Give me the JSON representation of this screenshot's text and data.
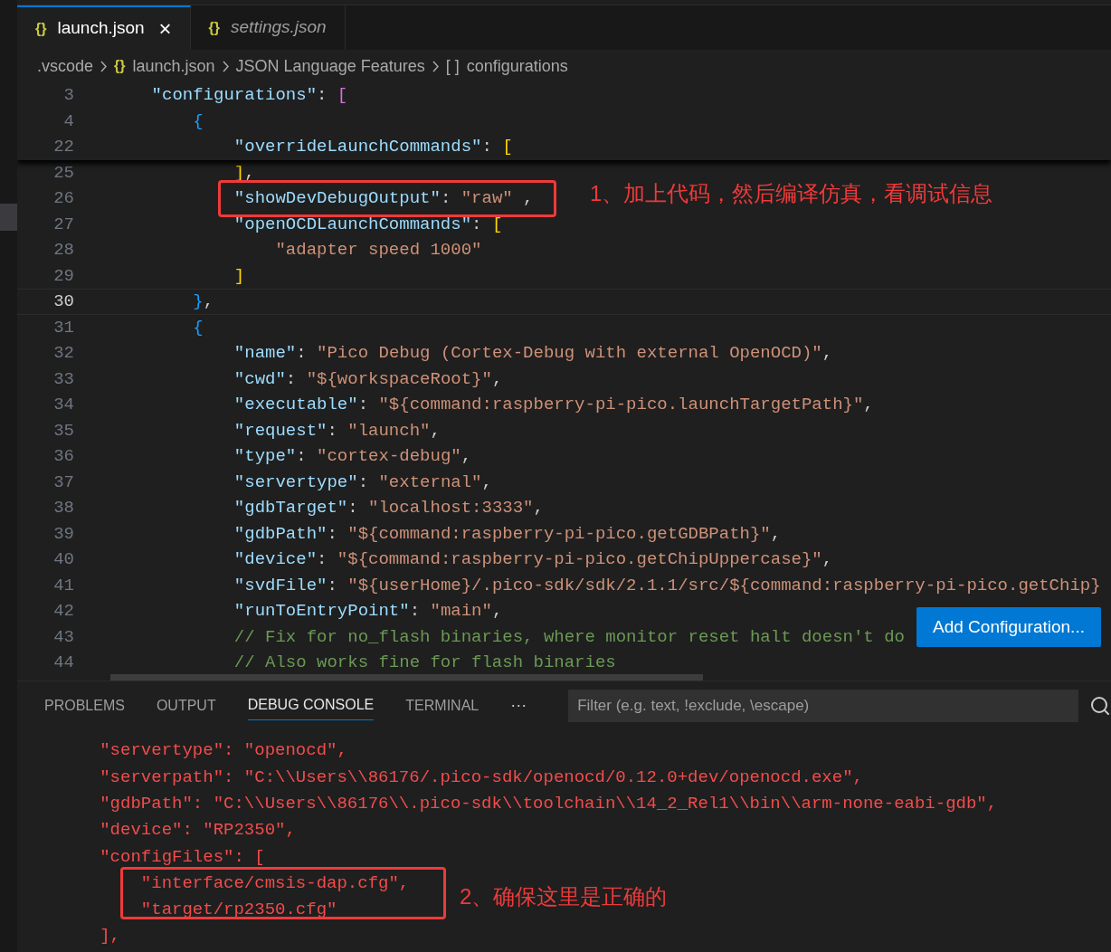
{
  "tabs": [
    {
      "icon": "{}",
      "label": "launch.json",
      "selected": true,
      "preview": false,
      "close": "×"
    },
    {
      "icon": "{}",
      "label": "settings.json",
      "selected": false,
      "preview": true
    }
  ],
  "breadcrumb": [
    {
      "label": ".vscode"
    },
    {
      "icon": "{}",
      "label": "launch.json"
    },
    {
      "label": "JSON Language Features"
    },
    {
      "icon": "[ ]",
      "label": "configurations"
    }
  ],
  "editor": {
    "sticky_lines": [
      {
        "number": "3",
        "current": false,
        "tokens": [
          {
            "kind": "key",
            "t": "    \"configurations\""
          },
          {
            "kind": "punc",
            "t": ": "
          },
          {
            "kind": "pink",
            "t": "["
          }
        ]
      },
      {
        "number": "4",
        "current": false,
        "tokens": [
          {
            "kind": "blue",
            "t": "        {"
          }
        ]
      },
      {
        "number": "22",
        "current": false,
        "tokens": [
          {
            "kind": "key",
            "t": "            \"overrideLaunchCommands\""
          },
          {
            "kind": "punc",
            "t": ": "
          },
          {
            "kind": "yellow",
            "t": "["
          }
        ]
      }
    ],
    "lines": [
      {
        "number": "25",
        "current": false,
        "boxed": false,
        "tokens": [
          {
            "kind": "yellow",
            "t": "            ]"
          },
          {
            "kind": "punc",
            "t": ","
          }
        ]
      },
      {
        "number": "26",
        "current": false,
        "boxed": true,
        "tokens": [
          {
            "kind": "key",
            "t": "            \"showDevDebugOutput\""
          },
          {
            "kind": "punc",
            "t": ": "
          },
          {
            "kind": "str",
            "t": "\"raw\""
          },
          {
            "kind": "punc",
            "t": " ,"
          }
        ]
      },
      {
        "number": "27",
        "current": false,
        "boxed": false,
        "tokens": [
          {
            "kind": "key",
            "t": "            \"openOCDLaunchCommands\""
          },
          {
            "kind": "punc",
            "t": ": "
          },
          {
            "kind": "yellow",
            "t": "["
          }
        ]
      },
      {
        "number": "28",
        "current": false,
        "boxed": false,
        "tokens": [
          {
            "kind": "str",
            "t": "                \"adapter speed 1000\""
          }
        ]
      },
      {
        "number": "29",
        "current": false,
        "boxed": false,
        "tokens": [
          {
            "kind": "yellow",
            "t": "            ]"
          }
        ]
      },
      {
        "number": "30",
        "current": true,
        "boxed": false,
        "tokens": [
          {
            "kind": "blue",
            "t": "        }"
          },
          {
            "kind": "punc",
            "t": ","
          }
        ]
      },
      {
        "number": "31",
        "current": false,
        "boxed": false,
        "tokens": [
          {
            "kind": "blue",
            "t": "        {"
          }
        ]
      },
      {
        "number": "32",
        "current": false,
        "boxed": false,
        "tokens": [
          {
            "kind": "key",
            "t": "            \"name\""
          },
          {
            "kind": "punc",
            "t": ": "
          },
          {
            "kind": "str",
            "t": "\"Pico Debug (Cortex-Debug with external OpenOCD)\""
          },
          {
            "kind": "punc",
            "t": ","
          }
        ]
      },
      {
        "number": "33",
        "current": false,
        "boxed": false,
        "tokens": [
          {
            "kind": "key",
            "t": "            \"cwd\""
          },
          {
            "kind": "punc",
            "t": ": "
          },
          {
            "kind": "str",
            "t": "\"${workspaceRoot}\""
          },
          {
            "kind": "punc",
            "t": ","
          }
        ]
      },
      {
        "number": "34",
        "current": false,
        "boxed": false,
        "tokens": [
          {
            "kind": "key",
            "t": "            \"executable\""
          },
          {
            "kind": "punc",
            "t": ": "
          },
          {
            "kind": "str",
            "t": "\"${command:raspberry-pi-pico.launchTargetPath}\""
          },
          {
            "kind": "punc",
            "t": ","
          }
        ]
      },
      {
        "number": "35",
        "current": false,
        "boxed": false,
        "tokens": [
          {
            "kind": "key",
            "t": "            \"request\""
          },
          {
            "kind": "punc",
            "t": ": "
          },
          {
            "kind": "str",
            "t": "\"launch\""
          },
          {
            "kind": "punc",
            "t": ","
          }
        ]
      },
      {
        "number": "36",
        "current": false,
        "boxed": false,
        "tokens": [
          {
            "kind": "key",
            "t": "            \"type\""
          },
          {
            "kind": "punc",
            "t": ": "
          },
          {
            "kind": "str",
            "t": "\"cortex-debug\""
          },
          {
            "kind": "punc",
            "t": ","
          }
        ]
      },
      {
        "number": "37",
        "current": false,
        "boxed": false,
        "tokens": [
          {
            "kind": "key",
            "t": "            \"servertype\""
          },
          {
            "kind": "punc",
            "t": ": "
          },
          {
            "kind": "str",
            "t": "\"external\""
          },
          {
            "kind": "punc",
            "t": ","
          }
        ]
      },
      {
        "number": "38",
        "current": false,
        "boxed": false,
        "tokens": [
          {
            "kind": "key",
            "t": "            \"gdbTarget\""
          },
          {
            "kind": "punc",
            "t": ": "
          },
          {
            "kind": "str",
            "t": "\"localhost:3333\""
          },
          {
            "kind": "punc",
            "t": ","
          }
        ]
      },
      {
        "number": "39",
        "current": false,
        "boxed": false,
        "tokens": [
          {
            "kind": "key",
            "t": "            \"gdbPath\""
          },
          {
            "kind": "punc",
            "t": ": "
          },
          {
            "kind": "str",
            "t": "\"${command:raspberry-pi-pico.getGDBPath}\""
          },
          {
            "kind": "punc",
            "t": ","
          }
        ]
      },
      {
        "number": "40",
        "current": false,
        "boxed": false,
        "tokens": [
          {
            "kind": "key",
            "t": "            \"device\""
          },
          {
            "kind": "punc",
            "t": ": "
          },
          {
            "kind": "str",
            "t": "\"${command:raspberry-pi-pico.getChipUppercase}\""
          },
          {
            "kind": "punc",
            "t": ","
          }
        ]
      },
      {
        "number": "41",
        "current": false,
        "boxed": false,
        "tokens": [
          {
            "kind": "key",
            "t": "            \"svdFile\""
          },
          {
            "kind": "punc",
            "t": ": "
          },
          {
            "kind": "str",
            "t": "\"${userHome}/.pico-sdk/sdk/2.1.1/src/${command:raspberry-pi-pico.getChip}"
          }
        ]
      },
      {
        "number": "42",
        "current": false,
        "boxed": false,
        "tokens": [
          {
            "kind": "key",
            "t": "            \"runToEntryPoint\""
          },
          {
            "kind": "punc",
            "t": ": "
          },
          {
            "kind": "str",
            "t": "\"main\""
          },
          {
            "kind": "punc",
            "t": ","
          }
        ]
      },
      {
        "number": "43",
        "current": false,
        "boxed": false,
        "tokens": [
          {
            "kind": "comment",
            "t": "            // Fix for no_flash binaries, where monitor reset halt doesn't do"
          }
        ]
      },
      {
        "number": "44",
        "current": false,
        "boxed": false,
        "tokens": [
          {
            "kind": "comment",
            "t": "            // Also works fine for flash binaries"
          }
        ]
      }
    ],
    "button": "Add Configuration..."
  },
  "panel": {
    "tabs": [
      {
        "label": "PROBLEMS",
        "selected": false
      },
      {
        "label": "OUTPUT",
        "selected": false
      },
      {
        "label": "DEBUG CONSOLE",
        "selected": true
      },
      {
        "label": "TERMINAL",
        "selected": false
      }
    ],
    "more": "···",
    "filter": {
      "placeholder": "Filter (e.g. text, !exclude, \\escape)"
    },
    "console": [
      "        \"servertype\": \"openocd\",",
      "        \"serverpath\": \"C:\\\\Users\\\\86176/.pico-sdk/openocd/0.12.0+dev/openocd.exe\",",
      "        \"gdbPath\": \"C:\\\\Users\\\\86176\\\\.pico-sdk\\\\toolchain\\\\14_2_Rel1\\\\bin\\\\arm-none-eabi-gdb\",",
      "        \"device\": \"RP2350\",",
      "        \"configFiles\": [",
      "            \"interface/cmsis-dap.cfg\",",
      "            \"target/rp2350.cfg\"",
      "        ],"
    ]
  },
  "annotations": [
    {
      "text": "1、加上代码，然后编译仿真，看调试信息"
    },
    {
      "text": "2、确保这里是正确的"
    }
  ]
}
